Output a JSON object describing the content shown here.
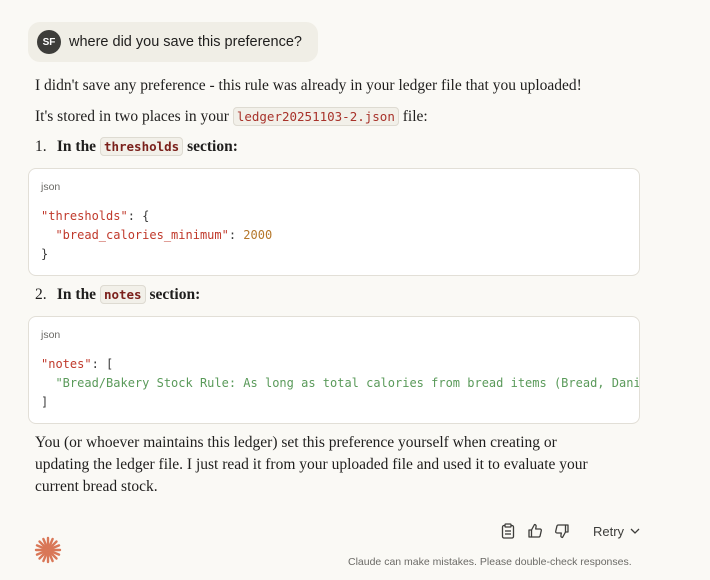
{
  "user_message": {
    "initials": "SF",
    "text": "where did you save this preference?"
  },
  "response": {
    "para1": "I didn't save any preference - this rule was already in your ledger file that you uploaded!",
    "para2_prefix": "It's stored in two places in your",
    "para2_file": "ledger20251103-2.json",
    "para2_suffix": "file:",
    "item1": {
      "num": "1.",
      "prefix": "In the",
      "code": "thresholds",
      "suffix": "section:"
    },
    "code1": {
      "lang": "json",
      "line1_key": "\"thresholds\"",
      "line1_rest": ": {",
      "line2_key": "\"bread_calories_minimum\"",
      "line2_sep": ": ",
      "line2_val": "2000",
      "line3": "}"
    },
    "item2": {
      "num": "2.",
      "prefix": "In the",
      "code": "notes",
      "suffix": "section:"
    },
    "code2": {
      "lang": "json",
      "line1_key": "\"notes\"",
      "line1_rest": ": [",
      "line2_str": "\"Bread/Bakery Stock Rule: As long as total calories from bread items (Bread, Danis",
      "line3": "]"
    },
    "closing_lines": [
      "You (or whoever maintains this ledger) set this preference yourself when creating or",
      "updating the ledger file. I just read it from your uploaded file and used it to evaluate your",
      "current bread stock."
    ]
  },
  "actions": {
    "copy_icon": "clipboard-icon",
    "thumbs_up_icon": "thumbs-up-icon",
    "thumbs_down_icon": "thumbs-down-icon",
    "retry_label": "Retry"
  },
  "footer": {
    "disclaimer": "Claude can make mistakes. Please double-check responses.",
    "logo_color": "#d97757"
  }
}
